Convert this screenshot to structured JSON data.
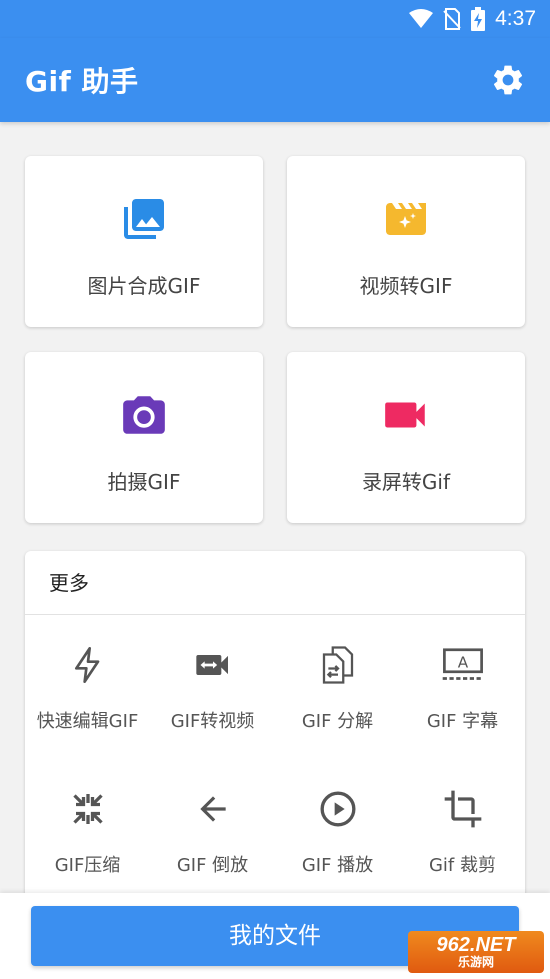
{
  "status_bar": {
    "time": "4:37"
  },
  "app_bar": {
    "title": "Gif 助手"
  },
  "cards": [
    {
      "label": "图片合成GIF",
      "icon": "image-collection-icon",
      "color": "#2a8ce6"
    },
    {
      "label": "视频转GIF",
      "icon": "movie-creation-icon",
      "color": "#f5b82e"
    },
    {
      "label": "拍摄GIF",
      "icon": "camera-icon",
      "color": "#6a3ab8"
    },
    {
      "label": "录屏转Gif",
      "icon": "videocam-icon",
      "color": "#ee2a62"
    }
  ],
  "more": {
    "heading": "更多",
    "tools": [
      {
        "label": "快速编辑GIF",
        "icon": "flash-icon"
      },
      {
        "label": "GIF转视频",
        "icon": "gif-to-video-icon"
      },
      {
        "label": "GIF 分解",
        "icon": "split-frames-icon"
      },
      {
        "label": "GIF 字幕",
        "icon": "subtitle-icon"
      },
      {
        "label": "GIF压缩",
        "icon": "compress-icon"
      },
      {
        "label": "GIF 倒放",
        "icon": "arrow-back-icon"
      },
      {
        "label": "GIF 播放",
        "icon": "play-circle-icon"
      },
      {
        "label": "Gif 裁剪",
        "icon": "crop-icon"
      }
    ]
  },
  "bottom": {
    "files_button": "我的文件"
  },
  "watermark": {
    "line1": "962.NET",
    "line2": "乐游网"
  },
  "colors": {
    "primary": "#3b8ff0"
  }
}
